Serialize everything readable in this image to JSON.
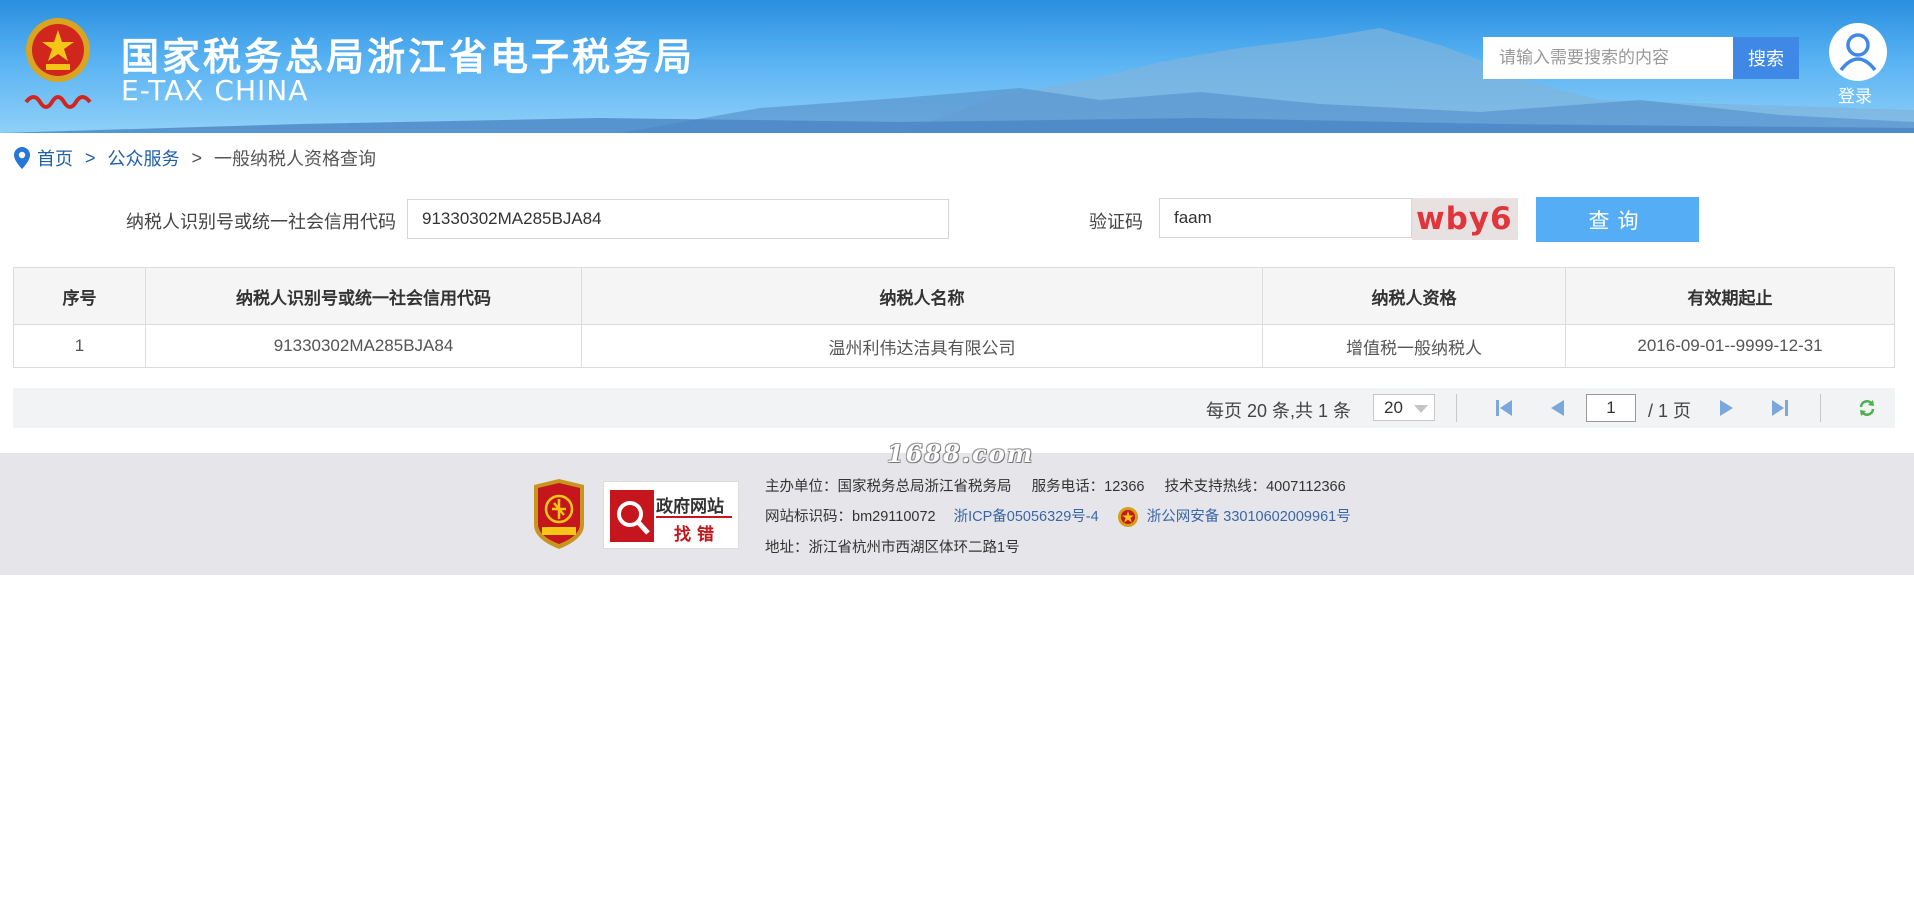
{
  "header": {
    "title": "国家税务总局浙江省电子税务局",
    "subtitle": "E-TAX CHINA",
    "search_placeholder": "请输入需要搜索的内容",
    "search_button": "搜索",
    "login_label": "登录"
  },
  "breadcrumb": {
    "home": "首页",
    "sep1": ">",
    "section": "公众服务",
    "sep2": ">",
    "current": "一般纳税人资格查询"
  },
  "form": {
    "id_label": "纳税人识别号或统一社会信用代码",
    "id_value": "91330302MA285BJA84",
    "captcha_label": "验证码",
    "captcha_value": "faam",
    "captcha_image_text": "wby6",
    "query_button": "查询"
  },
  "table": {
    "headers": [
      "序号",
      "纳税人识别号或统一社会信用代码",
      "纳税人名称",
      "纳税人资格",
      "有效期起止"
    ],
    "rows": [
      [
        "1",
        "91330302MA285BJA84",
        "温州利伟达洁具有限公司",
        "增值税一般纳税人",
        "2016-09-01--9999-12-31"
      ]
    ]
  },
  "pager": {
    "summary": "每页 20 条,共 1 条",
    "page_size": "20",
    "current_page": "1",
    "total_pages": "/ 1 页"
  },
  "watermark": "1688.com",
  "footer": {
    "line1": "主办单位：国家税务总局浙江省税务局     服务电话：12366     技术支持热线：4007112366",
    "site_id": "网站标识码：bm29110072",
    "icp": "浙ICP备05056329号-4",
    "police": "浙公网安备 33010602009961号",
    "address": "地址：浙江省杭州市西湖区体环二路1号",
    "zhaocuo_title": "政府网站",
    "zhaocuo_sub": "找错"
  },
  "colors": {
    "header_top": "#2a8fe0",
    "accent_blue": "#3f88e6",
    "query_button": "#55aef5",
    "link": "#1e5fa8",
    "captcha_red": "#e0353a"
  }
}
